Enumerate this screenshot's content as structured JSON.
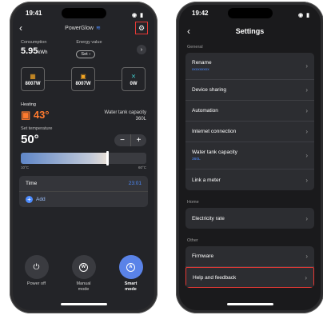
{
  "left": {
    "status_time": "19:41",
    "nav_title": "PowerGlow",
    "consumption": {
      "label": "Consumption",
      "value": "5.95",
      "unit": "kWh"
    },
    "energy": {
      "label": "Energy value",
      "button": "Set"
    },
    "flow": [
      {
        "icon": "solar-panel-icon",
        "value": "8007W"
      },
      {
        "icon": "battery-icon",
        "value": "8007W"
      },
      {
        "icon": "tower-icon",
        "value": "0W"
      }
    ],
    "heating": {
      "label": "Heating",
      "value": "43°"
    },
    "tank": {
      "label": "Water tank capacity",
      "value": "360L"
    },
    "set_temp": {
      "label": "Set temperature",
      "value": "50°"
    },
    "slider": {
      "min_label": "10°C",
      "max_label": "60°C",
      "level_fraction": 0.68
    },
    "time": {
      "label": "Time",
      "value": "23:01"
    },
    "add_label": "Add",
    "modes": [
      {
        "name": "power-off",
        "label": "Power off",
        "active": false
      },
      {
        "name": "manual-mode",
        "label": "Manual mode",
        "active": false
      },
      {
        "name": "smart-mode",
        "label": "Smart mode",
        "active": true
      }
    ]
  },
  "right": {
    "status_time": "19:42",
    "title": "Settings",
    "sections": {
      "general": "General",
      "home": "Home",
      "other": "Other"
    },
    "general_items": {
      "rename": "Rename",
      "rename_value": "xxxxxxxxx",
      "device_sharing": "Device sharing",
      "automation": "Automation",
      "internet_connection": "Internet connection",
      "water_tank_capacity": "Water tank capacity",
      "water_tank_value": "360L",
      "link_meter": "Link a meter"
    },
    "home_items": {
      "electricity_rate": "Electricity rate"
    },
    "other_items": {
      "firmware": "Firmware",
      "help_feedback": "Help and feedback"
    }
  },
  "colors": {
    "accent_blue": "#4d8cff",
    "heating_orange": "#ff7a2e",
    "highlight_red": "#e53935"
  }
}
